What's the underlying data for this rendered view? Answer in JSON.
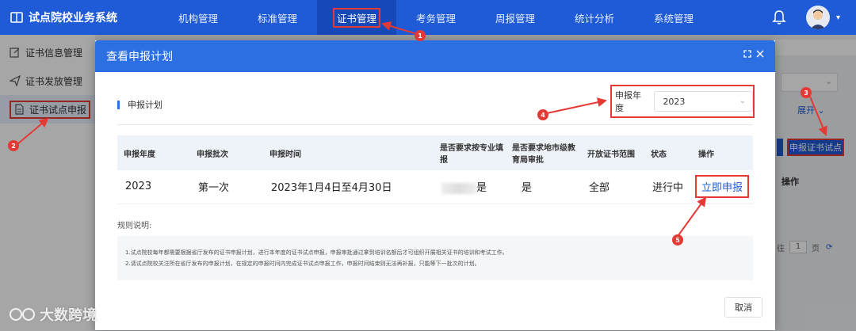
{
  "app": {
    "title": "试点院校业务系统"
  },
  "nav": {
    "items": [
      {
        "label": "机构管理"
      },
      {
        "label": "标准管理"
      },
      {
        "label": "证书管理"
      },
      {
        "label": "考务管理"
      },
      {
        "label": "周报管理"
      },
      {
        "label": "统计分析"
      },
      {
        "label": "系统管理"
      }
    ],
    "active_index": 2
  },
  "sidebar": {
    "items": [
      {
        "label": "证书信息管理",
        "icon": "edit-icon"
      },
      {
        "label": "证书发放管理",
        "icon": "send-icon"
      },
      {
        "label": "证书试点申报",
        "icon": "document-icon"
      }
    ],
    "active_index": 2
  },
  "background": {
    "expand_label": "展开",
    "apply_button": "申报证书试点",
    "table_header": "操作",
    "pagination": {
      "prefix": "往",
      "page": "1",
      "suffix": "页"
    }
  },
  "modal": {
    "title": "查看申报计划",
    "section_title": "申报计划",
    "year_label": "申报年度",
    "year_value": "2023",
    "table": {
      "headers": [
        "申报年度",
        "申报批次",
        "申报时间",
        "是否要求按专业填报",
        "是否要求地市级教育局审批",
        "开放证书范围",
        "状态",
        "操作"
      ],
      "rows": [
        {
          "year": "2023",
          "batch": "第一次",
          "time": "2023年1月4日至4月30日",
          "by_major": "是",
          "city_approval": "是",
          "scope": "全部",
          "status": "进行中",
          "action": "立即申报"
        }
      ]
    },
    "rules_label": "规则说明:",
    "rules": [
      "1.试点院校每年都需要根据省厅发布的证书申报计划，进行本年度的证书试点申报，申报审批通过拿到培训名额后才可组织开展相关证书的培训和考试工作。",
      "2.请试点院校关注所在省厅发布的申报计划，在规定的申报时间内完成证书试点申报工作，申报时间结束则无法再补报，只能等下一批次的计划。"
    ],
    "cancel_label": "取消"
  },
  "callouts": [
    "1",
    "2",
    "3",
    "4",
    "5"
  ],
  "watermark": "大数跨境",
  "colors": {
    "primary": "#1f5bd6",
    "highlight": "#e53935"
  }
}
